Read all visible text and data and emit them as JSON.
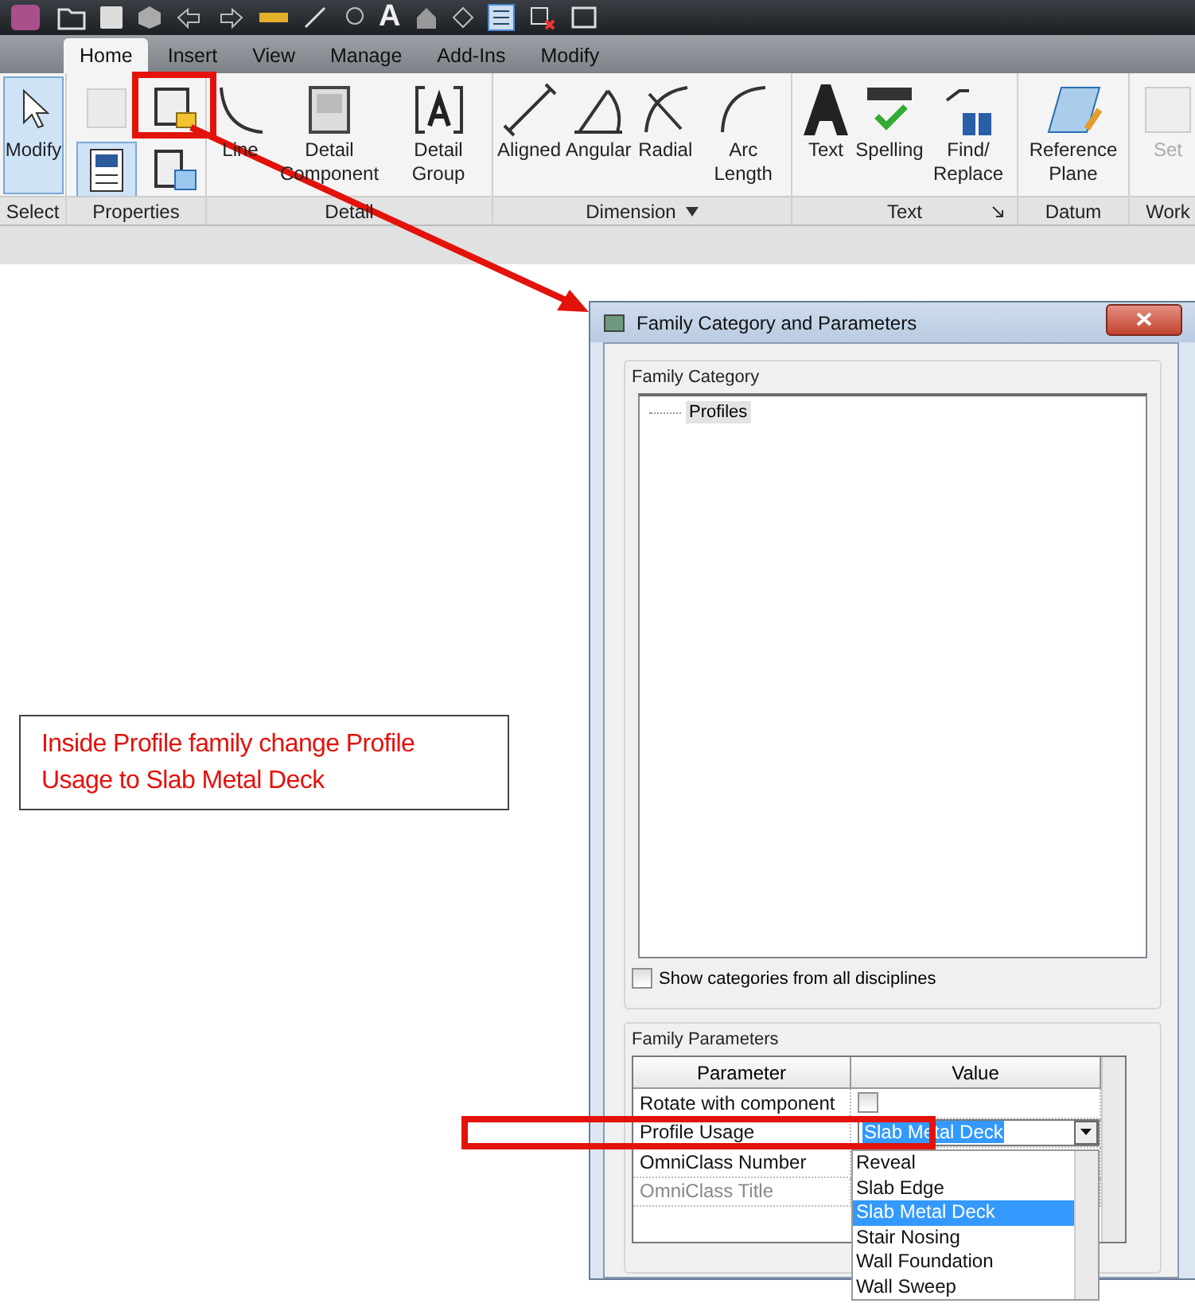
{
  "quick_access": {
    "glyph": "A"
  },
  "tabs": [
    {
      "label": "Home",
      "selected": true
    },
    {
      "label": "Insert",
      "selected": false
    },
    {
      "label": "View",
      "selected": false
    },
    {
      "label": "Manage",
      "selected": false
    },
    {
      "label": "Add-Ins",
      "selected": false
    },
    {
      "label": "Modify",
      "selected": false
    }
  ],
  "ribbon": {
    "panels": [
      {
        "label": "Select",
        "tools": [
          {
            "label": "Modify",
            "selected": true,
            "disabled": false
          }
        ]
      },
      {
        "label": "Properties",
        "buttons": [
          {
            "selected": false,
            "disabled": true
          },
          {
            "selected": false,
            "disabled": false
          },
          {
            "selected": true,
            "disabled": false
          },
          {
            "selected": false,
            "disabled": false
          }
        ]
      },
      {
        "label": "Detail",
        "tools": [
          {
            "label": "Line",
            "selected": false,
            "disabled": false
          },
          {
            "label": "Detail Component",
            "selected": false,
            "disabled": false
          },
          {
            "label": "Detail Group",
            "selected": false,
            "disabled": false
          }
        ]
      },
      {
        "label": "Dimension",
        "dropdown": true,
        "tools": [
          {
            "label": "Aligned",
            "selected": false,
            "disabled": false
          },
          {
            "label": "Angular",
            "selected": false,
            "disabled": false
          },
          {
            "label": "Radial",
            "selected": false,
            "disabled": false
          },
          {
            "label": "Arc Length",
            "selected": false,
            "disabled": false
          }
        ]
      },
      {
        "label": "Text",
        "launcher": true,
        "tools": [
          {
            "label": "Text",
            "selected": false,
            "disabled": false
          },
          {
            "label": "Spelling",
            "selected": false,
            "disabled": false
          },
          {
            "label": "Find/ Replace",
            "selected": false,
            "disabled": false
          }
        ]
      },
      {
        "label": "Datum",
        "tools": [
          {
            "label": "Reference Plane",
            "selected": false,
            "disabled": false
          }
        ]
      },
      {
        "label": "Work",
        "tools": [
          {
            "label": "Set",
            "selected": false,
            "disabled": true
          }
        ]
      }
    ]
  },
  "note": {
    "text": "Inside Profile family change Profile Usage to Slab Metal Deck"
  },
  "dialog": {
    "title": "Family Category and Parameters",
    "category_group": {
      "label": "Family Category",
      "tree": [
        {
          "label": "Profiles",
          "selected": true
        }
      ]
    },
    "show_all": {
      "label": "Show categories from all disciplines",
      "checked": false
    },
    "parameters_group": {
      "label": "Family Parameters",
      "columns": [
        "Parameter",
        "Value"
      ],
      "rows": [
        {
          "name": "Rotate with component",
          "kind": "checkbox",
          "checked": false,
          "disabled": false
        },
        {
          "name": "Profile Usage",
          "kind": "dropdown",
          "value": "Slab Metal Deck",
          "disabled": false
        },
        {
          "name": "OmniClass Number",
          "kind": "text",
          "disabled": false
        },
        {
          "name": "OmniClass Title",
          "kind": "text",
          "disabled": true
        }
      ],
      "dropdown_options": [
        {
          "label": "Reveal",
          "selected": false
        },
        {
          "label": "Slab Edge",
          "selected": false
        },
        {
          "label": "Slab Metal Deck",
          "selected": true
        },
        {
          "label": "Stair Nosing",
          "selected": false
        },
        {
          "label": "Wall Foundation",
          "selected": false
        },
        {
          "label": "Wall Sweep",
          "selected": false
        }
      ]
    }
  }
}
